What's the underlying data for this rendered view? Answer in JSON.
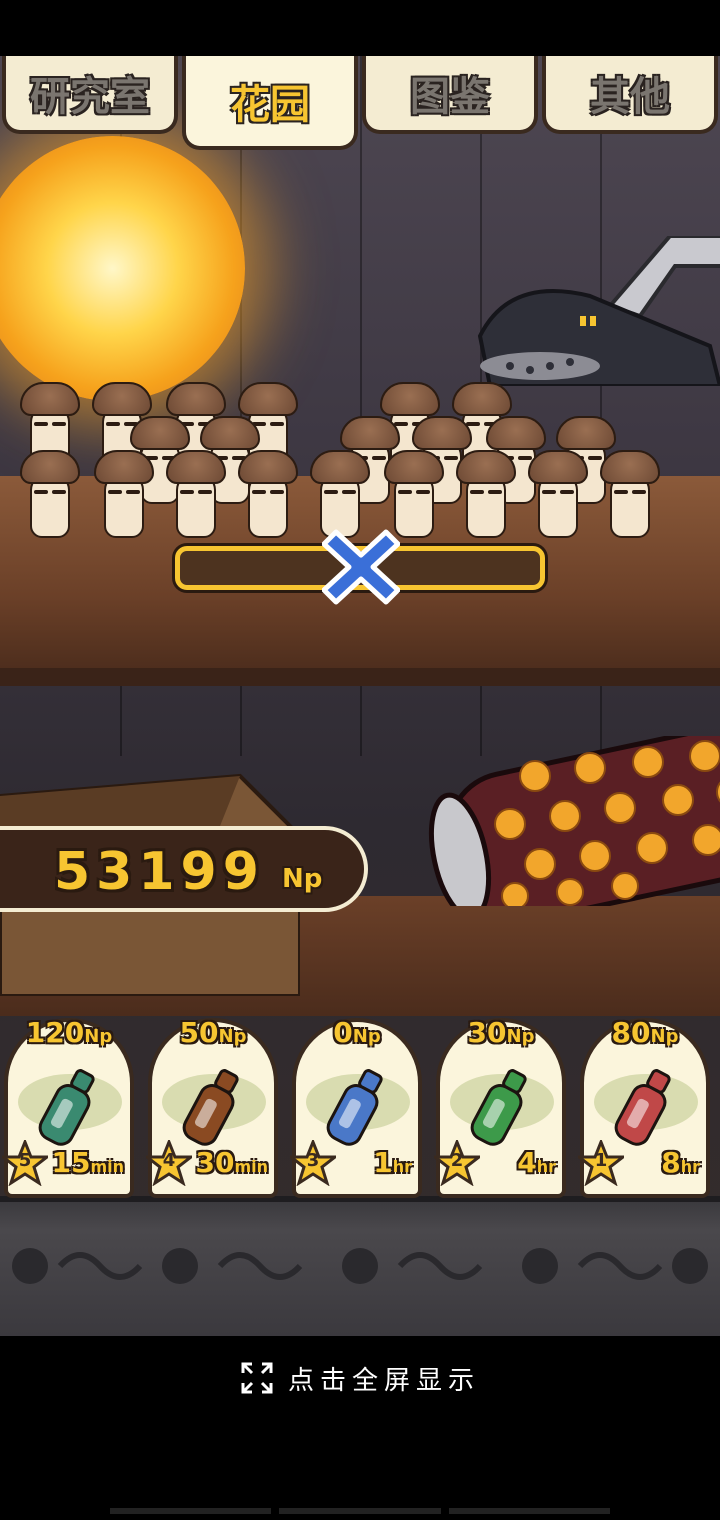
{
  "tabs": [
    {
      "label": "研究室",
      "active": false
    },
    {
      "label": "花园",
      "active": true
    },
    {
      "label": "图鉴",
      "active": false
    },
    {
      "label": "其他",
      "active": false
    }
  ],
  "growth_progress": 0,
  "money": {
    "amount": "53199",
    "unit": "Np"
  },
  "shop_items": [
    {
      "price": "120",
      "price_unit": "Np",
      "level": "5",
      "time": "15",
      "time_unit": "min",
      "icon": "green-bottle-icon",
      "color": "#3a8a70"
    },
    {
      "price": "50",
      "price_unit": "Np",
      "level": "4",
      "time": "30",
      "time_unit": "min",
      "icon": "brown-bottle-icon",
      "color": "#8a4a22"
    },
    {
      "price": "0",
      "price_unit": "Np",
      "level": "3",
      "time": "1",
      "time_unit": "hr",
      "icon": "blue-ampoule-icon",
      "color": "#4a78c8"
    },
    {
      "price": "30",
      "price_unit": "Np",
      "level": "2",
      "time": "4",
      "time_unit": "hr",
      "icon": "green-ampoule-icon",
      "color": "#3d9a4a"
    },
    {
      "price": "80",
      "price_unit": "Np",
      "level": "1",
      "time": "8",
      "time_unit": "hr",
      "icon": "red-ampoule-icon",
      "color": "#c04848"
    }
  ],
  "hint": {
    "text": "点击全屏显示",
    "icon": "fullscreen-icon"
  },
  "colors": {
    "accent": "#f7c531",
    "card_bg": "#fbf5dc",
    "outline": "#3a2a1f"
  }
}
